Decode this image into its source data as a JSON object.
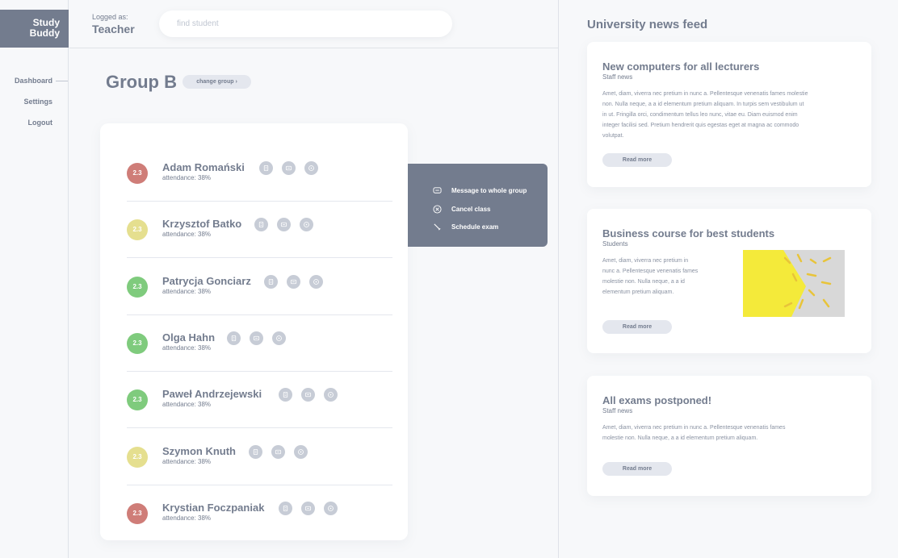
{
  "app": {
    "logo_line1": "Study",
    "logo_line2": "Buddy"
  },
  "sidebar": {
    "items": [
      {
        "label": "Dashboard",
        "active": true
      },
      {
        "label": "Settings",
        "active": false
      },
      {
        "label": "Logout",
        "active": false
      }
    ]
  },
  "header": {
    "logged_as_label": "Logged as:",
    "role": "Teacher",
    "search_placeholder": "find student"
  },
  "group": {
    "title": "Group B",
    "change_label": "change group ›"
  },
  "colors": {
    "primary": "#737c8e",
    "grade_bad": "#cf7d78",
    "grade_mid": "#e5df8f",
    "grade_good": "#7fcb7d",
    "chip_bg": "#e4e7ee",
    "card_bg": "#ffffff",
    "page_bg": "#f7f8fa"
  },
  "students": [
    {
      "average": "2.3",
      "name": "Adam Romański",
      "attendance": "attendance: 38%",
      "grade_level": "bad"
    },
    {
      "average": "2.3",
      "name": "Krzysztof Batko",
      "attendance": "attendance: 38%",
      "grade_level": "mid"
    },
    {
      "average": "2.3",
      "name": "Patrycja Gonciarz",
      "attendance": "attendance: 38%",
      "grade_level": "good"
    },
    {
      "average": "2.3",
      "name": "Olga Hahn",
      "attendance": "attendance: 38%",
      "grade_level": "good"
    },
    {
      "average": "2.3",
      "name": "Paweł Andrzejewski",
      "attendance": "attendance: 38%",
      "grade_level": "good"
    },
    {
      "average": "2.3",
      "name": "Szymon Knuth",
      "attendance": "attendance: 38%",
      "grade_level": "mid"
    },
    {
      "average": "2.3",
      "name": "Krystian Foczpaniak",
      "attendance": "attendance: 38%",
      "grade_level": "bad"
    }
  ],
  "student_actions": [
    "details-icon",
    "message-icon",
    "options-icon"
  ],
  "popup_menu": [
    {
      "label": "Message to whole group",
      "icon": "message-icon"
    },
    {
      "label": "Cancel class",
      "icon": "cancel-icon"
    },
    {
      "label": "Schedule exam",
      "icon": "pencil-icon"
    }
  ],
  "news": {
    "heading": "University news feed",
    "articles": [
      {
        "title": "New computers for all lecturers",
        "category": "Staff news",
        "body_lines": [
          "Amet, diam, viverra nec pretium in nunc a. Pellentesque venenatis fames molestie",
          "non. Nulla neque, a a id elementum pretium aliquam. In turpis sem vestibulum ut",
          "in ut. Fringilla orci, condimentum tellus leo nunc, vitae eu. Diam euismod enim",
          "integer facilisi sed. Pretium hendrerit quis egestas eget at magna ac commodo",
          "volutpat."
        ],
        "read_more": "Read more"
      },
      {
        "title": "Business course for best students",
        "category": "Students",
        "body_lines": [
          "Amet, diam, viverra nec pretium in",
          "nunc a. Pellentesque venenatis fames",
          "molestie non. Nulla neque, a a id",
          "elementum pretium aliquam."
        ],
        "read_more": "Read more",
        "image": "paperclips-on-yellow"
      },
      {
        "title": "All exams postponed!",
        "category": "Staff news",
        "body_lines": [
          "Amet, diam, viverra nec pretium in nunc a. Pellentesque venenatis fames",
          "molestie non. Nulla neque, a a id elementum pretium aliquam."
        ],
        "read_more": "Read more"
      }
    ]
  }
}
